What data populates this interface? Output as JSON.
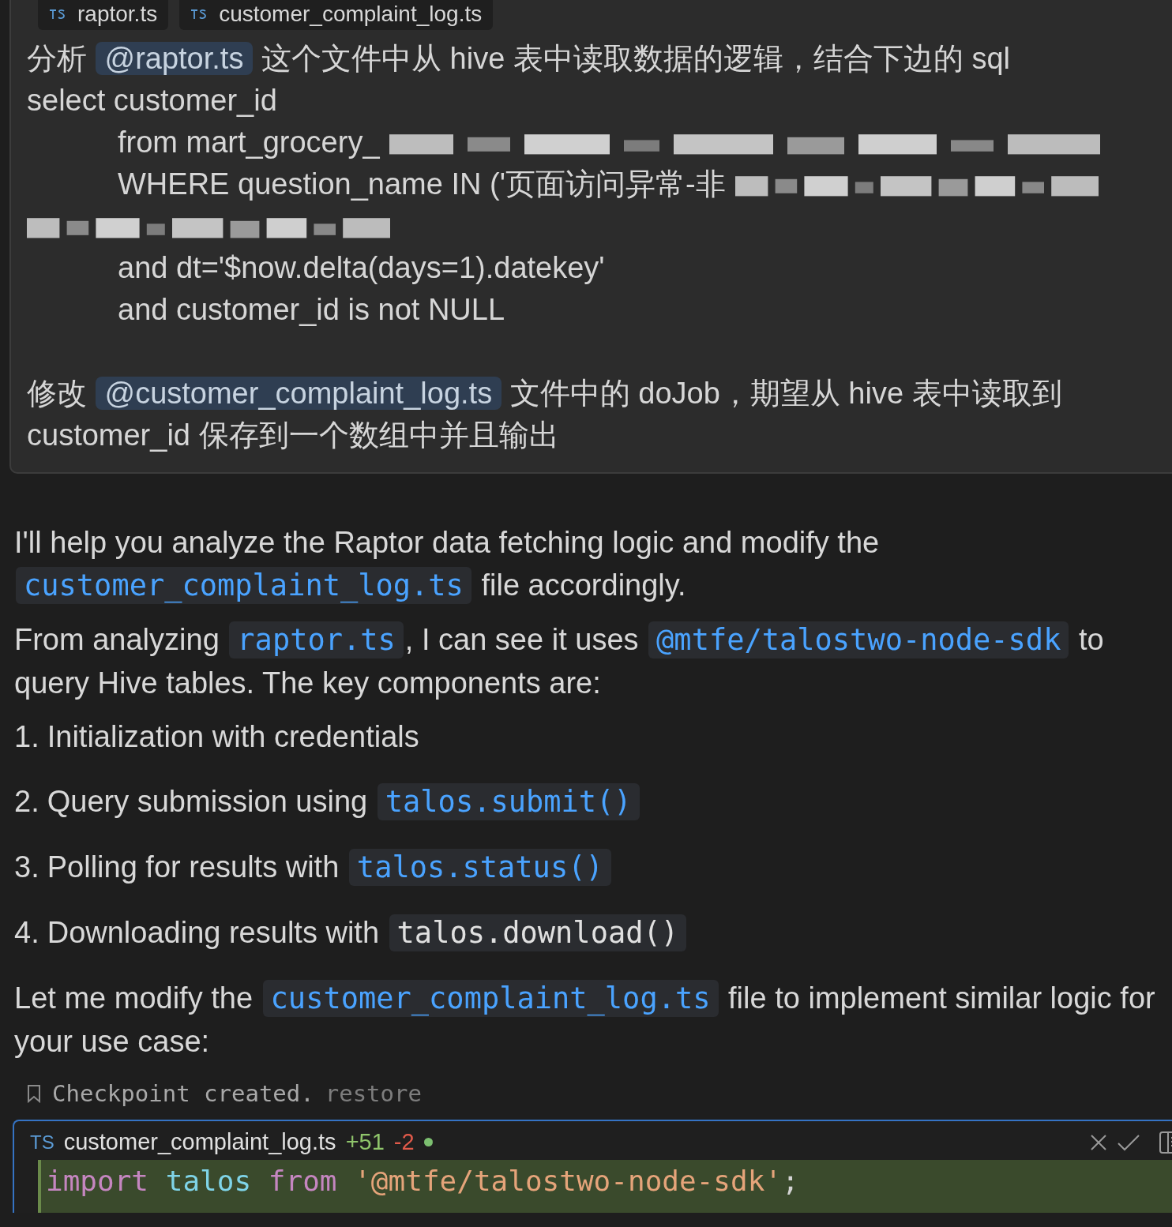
{
  "attached_files": [
    {
      "label": "raptor.ts"
    },
    {
      "label": "customer_complaint_log.ts"
    }
  ],
  "user_message": {
    "lines": [
      {
        "kind": "prompt",
        "segments": [
          {
            "kind": "text",
            "text": "分析"
          },
          {
            "kind": "mention",
            "text": "@raptor.ts"
          },
          {
            "kind": "text",
            "text": "这个文件中从 hive 表中读取数据的逻辑，结合下边的 sql"
          }
        ]
      },
      {
        "kind": "prompt",
        "segments": [
          {
            "kind": "text",
            "text": "select customer_id"
          }
        ]
      },
      {
        "kind": "sql",
        "segments": [
          {
            "kind": "text",
            "text": "from mart_grocery_"
          },
          {
            "kind": "redacted"
          }
        ]
      },
      {
        "kind": "sql",
        "segments": [
          {
            "kind": "text",
            "text": "WHERE question_name IN ('页面访问异常-非"
          },
          {
            "kind": "redacted"
          }
        ]
      },
      {
        "kind": "prompt",
        "segments": [
          {
            "kind": "redacted"
          }
        ]
      },
      {
        "kind": "sql",
        "segments": [
          {
            "kind": "text",
            "text": "and dt='$now.delta(days=1).datekey'"
          }
        ]
      },
      {
        "kind": "sql",
        "segments": [
          {
            "kind": "text",
            "text": "and customer_id is not NULL"
          }
        ]
      },
      {
        "kind": "blank"
      },
      {
        "kind": "prompt",
        "segments": [
          {
            "kind": "text",
            "text": "修改"
          },
          {
            "kind": "mention",
            "text": "@customer_complaint_log.ts"
          },
          {
            "kind": "text",
            "text": "文件中的 doJob，期望从 hive 表中读取到 customer_id 保存到一个数组中并且输出"
          }
        ]
      }
    ]
  },
  "response": {
    "blocks": [
      {
        "kind": "paragraph",
        "segments": [
          {
            "kind": "text",
            "text": "I'll help you analyze the Raptor data fetching logic and modify the "
          },
          {
            "kind": "code",
            "text": "customer_complaint_log.ts",
            "linked": true
          },
          {
            "kind": "text",
            "text": " file accordingly."
          }
        ]
      },
      {
        "kind": "paragraph",
        "segments": [
          {
            "kind": "text",
            "text": "From analyzing "
          },
          {
            "kind": "code",
            "text": "raptor.ts",
            "linked": true
          },
          {
            "kind": "text",
            "text": ", I can see it uses "
          },
          {
            "kind": "code",
            "text": "@mtfe/talostwo-node-sdk",
            "linked": true
          },
          {
            "kind": "text",
            "text": " to query Hive tables. The key components are:"
          }
        ]
      },
      {
        "kind": "list_item",
        "marker": "1.",
        "segments": [
          {
            "kind": "text",
            "text": "Initialization with credentials"
          }
        ]
      },
      {
        "kind": "list_item",
        "marker": "2.",
        "segments": [
          {
            "kind": "text",
            "text": "Query submission using "
          },
          {
            "kind": "code",
            "text": "talos.submit()",
            "linked": true
          }
        ]
      },
      {
        "kind": "list_item",
        "marker": "3.",
        "segments": [
          {
            "kind": "text",
            "text": "Polling for results with "
          },
          {
            "kind": "code",
            "text": "talos.status()",
            "linked": true
          }
        ]
      },
      {
        "kind": "list_item",
        "marker": "4.",
        "segments": [
          {
            "kind": "text",
            "text": "Downloading results with "
          },
          {
            "kind": "code",
            "text": "talos.download()",
            "linked": false
          }
        ]
      },
      {
        "kind": "paragraph",
        "segments": [
          {
            "kind": "text",
            "text": "Let me modify the "
          },
          {
            "kind": "code",
            "text": "customer_complaint_log.ts",
            "linked": true
          },
          {
            "kind": "text",
            "text": " file to implement similar logic for your use case:"
          }
        ]
      }
    ]
  },
  "checkpoint": {
    "text": "Checkpoint created.",
    "action": "restore"
  },
  "diff": {
    "file_type": "TS",
    "file_name": "customer_complaint_log.ts",
    "added": "+51",
    "removed": "-2",
    "unsaved": true,
    "lines": [
      {
        "added": true,
        "tokens": [
          {
            "kind": "keyword",
            "text": "import"
          },
          {
            "kind": "identifier",
            "text": "talos"
          },
          {
            "kind": "keyword",
            "text": "from"
          },
          {
            "kind": "string",
            "text": "'@mtfe/talostwo-node-sdk'"
          },
          {
            "kind": "punct",
            "text": ";"
          }
        ]
      }
    ]
  }
}
